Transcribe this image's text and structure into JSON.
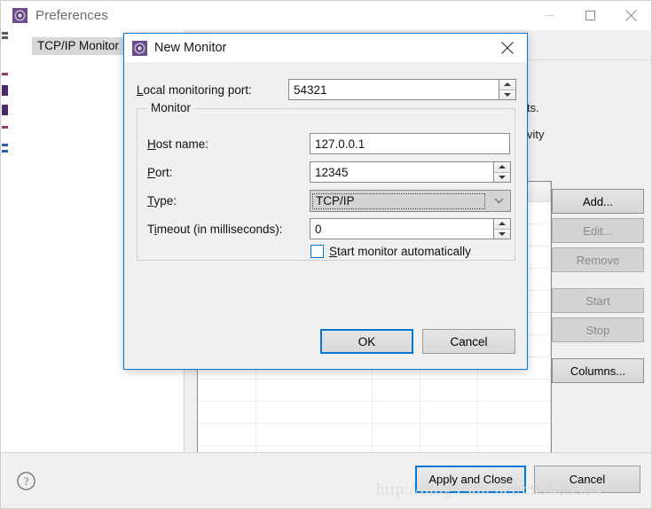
{
  "preferences_window": {
    "title": "Preferences",
    "icon": "eclipse-gear-icon",
    "window_controls": {
      "minimize": "minimize-icon",
      "maximize": "maximize-icon",
      "close": "close-icon"
    },
    "tree": {
      "selected_item": "TCP/IP Monitor"
    },
    "page": {
      "description_fragment_1": "ts.",
      "description_fragment_2": "vity",
      "browse_button": "...",
      "side_buttons": [
        {
          "label": "Add...",
          "enabled": true
        },
        {
          "label": "Edit...",
          "enabled": false
        },
        {
          "label": "Remove",
          "enabled": false
        },
        {
          "label": "Start",
          "enabled": false
        },
        {
          "label": "Stop",
          "enabled": false
        },
        {
          "label": "Columns...",
          "enabled": true
        }
      ]
    },
    "footer": {
      "help_icon": "help-question-icon",
      "apply_and_close": "Apply and Close",
      "cancel": "Cancel"
    }
  },
  "new_monitor_dialog": {
    "title": "New Monitor",
    "icon": "eclipse-gear-icon",
    "close_icon": "close-icon",
    "local_monitoring_port": {
      "label": "Local monitoring port:",
      "mnemonic": "L",
      "label_rest": "ocal monitoring port:",
      "value": "54321"
    },
    "group": {
      "label": "Monitor",
      "host_name": {
        "mnemonic": "H",
        "label_rest": "ost name:",
        "value": "127.0.0.1"
      },
      "port": {
        "mnemonic": "P",
        "label_rest": "ort:",
        "value": "12345"
      },
      "type": {
        "mnemonic": "T",
        "label_rest": "ype:",
        "selected": "TCP/IP"
      },
      "timeout": {
        "label_pre": "T",
        "mnemonic": "i",
        "label_rest": "meout (in milliseconds):",
        "value": "0"
      },
      "start_auto": {
        "mnemonic": "S",
        "label_rest": "tart monitor automatically",
        "checked": false
      }
    },
    "buttons": {
      "ok": "OK",
      "cancel": "Cancel"
    }
  },
  "watermark": "http://blog.csdn.net/c99463904",
  "colors": {
    "accent": "#0078d7",
    "dialog_bg": "#f0f0f0",
    "field_bg": "#ffffff",
    "disabled_text": "#8a8a8a"
  }
}
